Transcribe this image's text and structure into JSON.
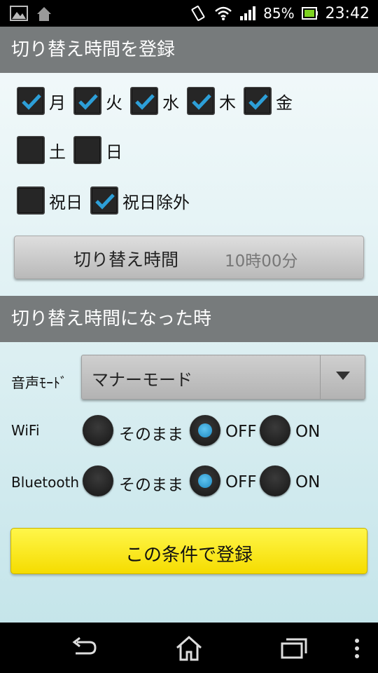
{
  "status_bar": {
    "battery": "85%",
    "time": "23:42",
    "icons": [
      "gallery-icon",
      "app-notification-icon",
      "vibrate-icon",
      "wifi-icon",
      "signal-icon",
      "battery-icon"
    ]
  },
  "section1": {
    "title": "切り替え時間を登録",
    "days": [
      {
        "label": "月",
        "checked": true
      },
      {
        "label": "火",
        "checked": true
      },
      {
        "label": "水",
        "checked": true
      },
      {
        "label": "木",
        "checked": true
      },
      {
        "label": "金",
        "checked": true
      },
      {
        "label": "土",
        "checked": false
      },
      {
        "label": "日",
        "checked": false
      }
    ],
    "holiday": {
      "label": "祝日",
      "checked": false
    },
    "holiday_excluded": {
      "label": "祝日除外",
      "checked": true
    },
    "time_button": {
      "label": "切り替え時間",
      "value": "10時00分"
    }
  },
  "section2": {
    "title": "切り替え時間になった時",
    "sound_mode": {
      "label": "音声ﾓｰﾄﾞ",
      "value": "マナーモード"
    },
    "wifi": {
      "label": "WiFi",
      "options": [
        "そのまま",
        "OFF",
        "ON"
      ],
      "selected": "OFF"
    },
    "bluetooth": {
      "label": "Bluetooth",
      "options": [
        "そのまま",
        "OFF",
        "ON"
      ],
      "selected": "OFF"
    }
  },
  "submit": {
    "label": "この条件で登録"
  },
  "colors": {
    "accent": "#2d9fd8",
    "header": "#777b7c",
    "submit": "#fff200"
  }
}
